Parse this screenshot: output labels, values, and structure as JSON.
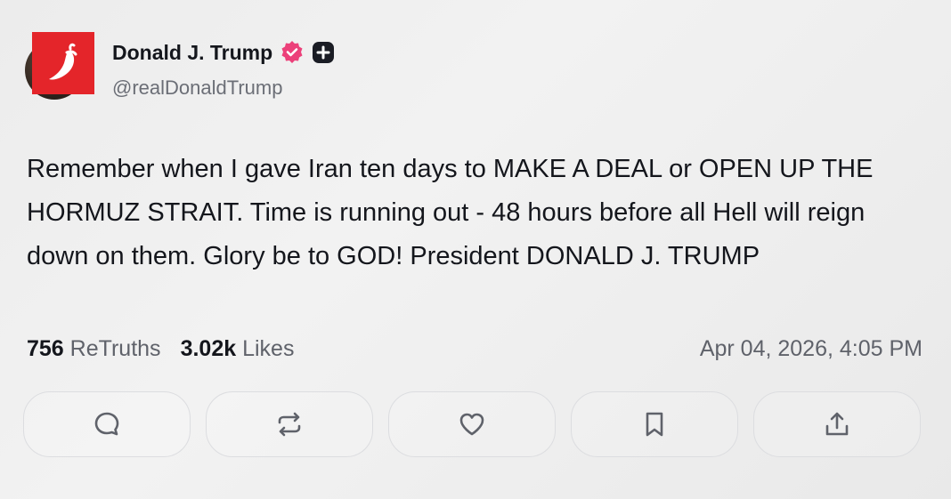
{
  "author": {
    "display_name": "Donald J. Trump",
    "handle": "@realDonaldTrump",
    "badge_color": "#e4252a",
    "verified_color": "#ec407a"
  },
  "post": {
    "text": "Remember when I gave Iran ten days to MAKE A DEAL or OPEN UP THE HORMUZ STRAIT. Time is running out - 48 hours before all Hell will reign down on them. Glory be to GOD! President DONALD J. TRUMP",
    "retruths_count": "756",
    "retruths_label": "ReTruths",
    "likes_count": "3.02k",
    "likes_label": "Likes",
    "timestamp": "Apr 04, 2026, 4:05 PM"
  },
  "actions": [
    {
      "icon": "reply-icon"
    },
    {
      "icon": "retruth-icon"
    },
    {
      "icon": "like-icon"
    },
    {
      "icon": "bookmark-icon"
    },
    {
      "icon": "share-icon"
    }
  ]
}
